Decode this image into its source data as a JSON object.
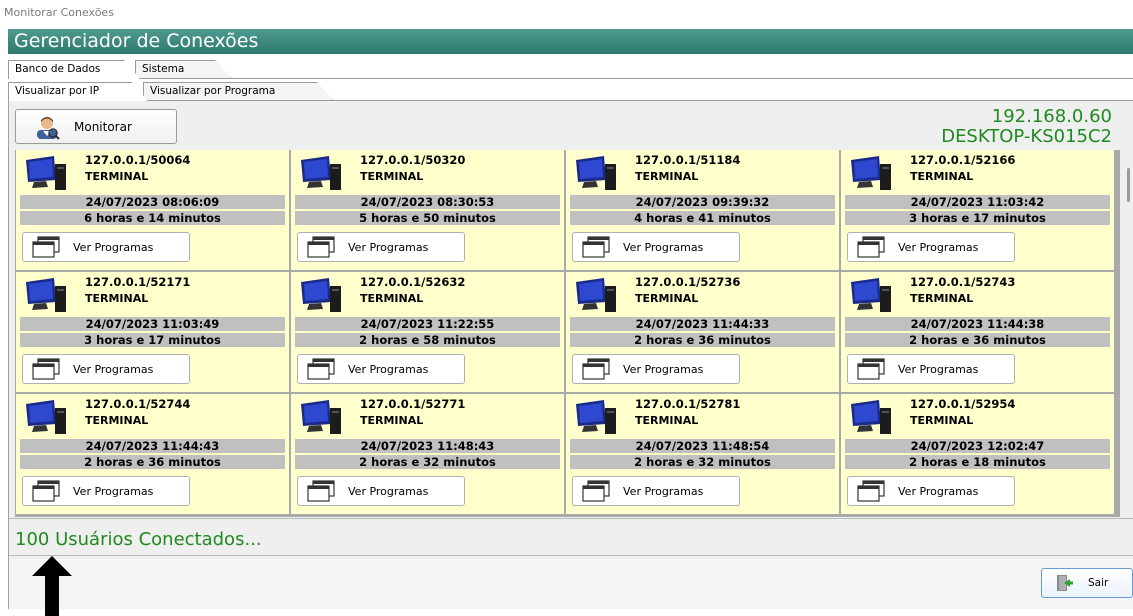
{
  "window": {
    "title": "Monitorar Conexões",
    "header": "Gerenciador de Conexões"
  },
  "tabs_top": [
    {
      "label": "Banco de Dados",
      "active": true
    },
    {
      "label": "Sistema",
      "active": false
    }
  ],
  "tabs_sub": [
    {
      "label": "Visualizar por IP",
      "active": true
    },
    {
      "label": "Visualizar por Programa",
      "active": false
    }
  ],
  "toolbar": {
    "monitor_label": "Monitorar",
    "host_ip": "192.168.0.60",
    "host_name": "DESKTOP-KS015C2"
  },
  "cards": [
    {
      "ip": "127.0.0.1/50064",
      "type": "TERMINAL",
      "date": "24/07/2023 08:06:09",
      "duration": "6 horas e 14 minutos",
      "button": "Ver Programas"
    },
    {
      "ip": "127.0.0.1/50320",
      "type": "TERMINAL",
      "date": "24/07/2023 08:30:53",
      "duration": "5 horas e 50 minutos",
      "button": "Ver Programas"
    },
    {
      "ip": "127.0.0.1/51184",
      "type": "TERMINAL",
      "date": "24/07/2023 09:39:32",
      "duration": "4 horas e 41 minutos",
      "button": "Ver Programas"
    },
    {
      "ip": "127.0.0.1/52166",
      "type": "TERMINAL",
      "date": "24/07/2023 11:03:42",
      "duration": "3 horas e 17 minutos",
      "button": "Ver Programas"
    },
    {
      "ip": "127.0.0.1/52171",
      "type": "TERMINAL",
      "date": "24/07/2023 11:03:49",
      "duration": "3 horas e 17 minutos",
      "button": "Ver Programas"
    },
    {
      "ip": "127.0.0.1/52632",
      "type": "TERMINAL",
      "date": "24/07/2023 11:22:55",
      "duration": "2 horas e 58 minutos",
      "button": "Ver Programas"
    },
    {
      "ip": "127.0.0.1/52736",
      "type": "TERMINAL",
      "date": "24/07/2023 11:44:33",
      "duration": "2 horas e 36 minutos",
      "button": "Ver Programas"
    },
    {
      "ip": "127.0.0.1/52743",
      "type": "TERMINAL",
      "date": "24/07/2023 11:44:38",
      "duration": "2 horas e 36 minutos",
      "button": "Ver Programas"
    },
    {
      "ip": "127.0.0.1/52744",
      "type": "TERMINAL",
      "date": "24/07/2023 11:44:43",
      "duration": "2 horas e 36 minutos",
      "button": "Ver Programas"
    },
    {
      "ip": "127.0.0.1/52771",
      "type": "TERMINAL",
      "date": "24/07/2023 11:48:43",
      "duration": "2 horas e 32 minutos",
      "button": "Ver Programas"
    },
    {
      "ip": "127.0.0.1/52781",
      "type": "TERMINAL",
      "date": "24/07/2023 11:48:54",
      "duration": "2 horas e 32 minutos",
      "button": "Ver Programas"
    },
    {
      "ip": "127.0.0.1/52954",
      "type": "TERMINAL",
      "date": "24/07/2023 12:02:47",
      "duration": "2 horas e 18 minutos",
      "button": "Ver Programas"
    }
  ],
  "status": {
    "connected_text": "100 Usuários Conectados..."
  },
  "footer": {
    "exit_label": "Sair"
  },
  "icons": {
    "monitor": "user-icon",
    "card": "computer-icon",
    "programs": "windows-icon",
    "exit": "exit-door-icon",
    "annotation": "arrow-up-icon"
  },
  "colors": {
    "header_bg": "#2f7a6f",
    "card_bg": "#ffffcc",
    "status_green": "#1f8a1f",
    "card_band": "#c0c0c0"
  }
}
